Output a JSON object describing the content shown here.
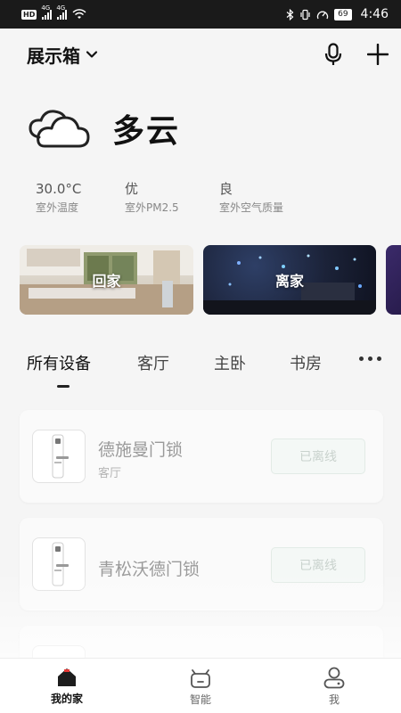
{
  "status_bar": {
    "time": "4:46",
    "battery": "69",
    "network": "4G",
    "hd": "HD"
  },
  "header": {
    "home_name": "展示箱"
  },
  "weather": {
    "condition": "多云",
    "metrics": [
      {
        "value": "30.0°C",
        "label": "室外温度"
      },
      {
        "value": "优",
        "label": "室外PM2.5"
      },
      {
        "value": "良",
        "label": "室外空气质量"
      }
    ]
  },
  "scenes": [
    {
      "label": "回家"
    },
    {
      "label": "离家"
    }
  ],
  "tabs": [
    {
      "label": "所有设备",
      "active": true
    },
    {
      "label": "客厅",
      "active": false
    },
    {
      "label": "主卧",
      "active": false
    },
    {
      "label": "书房",
      "active": false
    }
  ],
  "devices": [
    {
      "name": "德施曼门锁",
      "room": "客厅",
      "status": "已离线"
    },
    {
      "name": "青松沃德门锁",
      "room": "",
      "status": "已离线"
    }
  ],
  "bottom_nav": [
    {
      "label": "我的家",
      "icon": "home-icon",
      "active": true
    },
    {
      "label": "智能",
      "icon": "robot-icon",
      "active": false
    },
    {
      "label": "我",
      "icon": "user-icon",
      "active": false
    }
  ],
  "colors": {
    "accent": "#111111",
    "offline_text": "#c9d2cd",
    "home_icon_dot": "#e53935"
  }
}
